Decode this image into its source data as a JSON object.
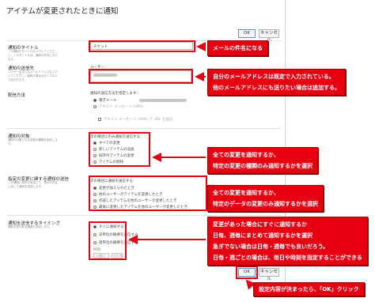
{
  "dialog": {
    "title": "アイテムが変更されたときに通知",
    "ok_label": "OK",
    "cancel_label": "キャンセル"
  },
  "sections": {
    "alert_title": {
      "title": "通知のタイトル",
      "desc": "この通知のタイトルを入力してください。このタイトルは、通知の件名になります。",
      "value": "チケット"
    },
    "send_to": {
      "title": "通知の送信先",
      "desc": "ユーザー名またはメールアドレスを入力してください。複数の場合はセミコロンで区切ります。",
      "users_label": "ユーザー:"
    },
    "delivery": {
      "title": "配信方法",
      "label": "通知の送信方法を指定します:",
      "email": "電子メール",
      "sms": "テキスト メッセージ (SMS)",
      "sms_url": "テキスト メッセージ (SMS) で URL を送信"
    },
    "change_type": {
      "title": "通知の対象",
      "desc": "通知の対象となる変更の種類を指定します。",
      "label": "次の場合にのみ通知を送信する:",
      "options": [
        "すべての変更",
        "新しいアイテムの追加",
        "既存のアイテムの変更",
        "アイテムの削除"
      ]
    },
    "filter": {
      "title": "指定の変更に関する通知の送信",
      "desc": "この通知に条件を設定して、表示の内容に応じて通知を送信します。",
      "label": "次の場合に通知を送信する:",
      "options": [
        "変更が加えられたとき",
        "他のユーザーがアイテムを変更したとき",
        "作成したアイテムを他のユーザーが変更したとき",
        "最後に変更したアイテムを他のユーザーが変更したとき"
      ]
    },
    "when": {
      "title": "通知を送信するタイミング",
      "desc": "通知を受け取る頻度を指定します。",
      "options": [
        "すぐに通知する",
        "日単位の概要を送信する",
        "週単位の概要を送信する"
      ],
      "time_label": "時刻:",
      "day_value": "土曜日",
      "time_value": "20:00"
    }
  },
  "callouts": {
    "title": "メールの件名になる",
    "send_to": [
      "自分のメールアドレスは既定で入力されている。",
      "他のメールアドレスにも送りたい場合は追加する。"
    ],
    "change_type": [
      "全ての変更を通知するか、",
      "特定の変更の種類のみ通知するかを選択"
    ],
    "filter": [
      "全ての変更を通知するか、",
      "特定のデータの変更のみ通知するかを選択"
    ],
    "when": [
      "変更があった場合にすぐに通知するか",
      "日毎、週毎にまとめて通知するかを選択",
      "急ぎでない場合は日毎・週毎でも良いだろう。",
      "日毎・週ごとの場合は、毎日や時刻を指定することができる"
    ],
    "ok": "設定内容が決まったら、「OK」クリック"
  },
  "colors": {
    "accent_red": "#e60012",
    "button_border": "#6d8ec4"
  }
}
